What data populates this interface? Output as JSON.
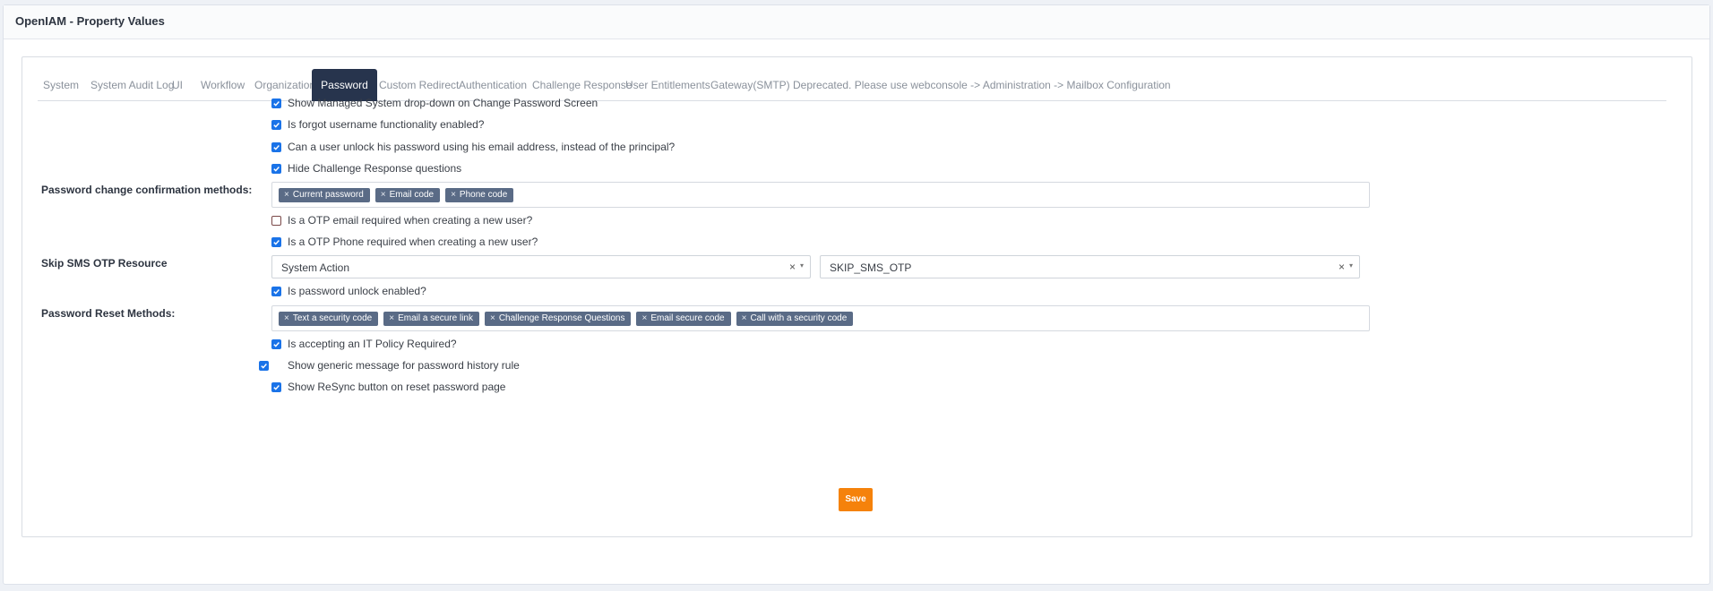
{
  "header": {
    "title": "OpenIAM - Property Values"
  },
  "tabs": [
    {
      "label": "System"
    },
    {
      "label": "System Audit Log"
    },
    {
      "label": "UI"
    },
    {
      "label": "Workflow"
    },
    {
      "label": "Organization"
    },
    {
      "label": "Password",
      "active": true
    },
    {
      "label": "Custom Redirect"
    },
    {
      "label": "Authentication"
    },
    {
      "label": "Challenge Response"
    },
    {
      "label": "User Entitlements"
    },
    {
      "label": "Gateway(SMTP) Deprecated. Please use webconsole -> Administration -> Mailbox Configuration"
    }
  ],
  "form": {
    "show_managed_system": {
      "label": "Show Managed System drop-down on Change Password Screen",
      "checked": true
    },
    "forgot_username": {
      "label": "Is forgot username functionality enabled?",
      "checked": true
    },
    "unlock_by_email": {
      "label": "Can a user unlock his password using his email address, instead of the principal?",
      "checked": true
    },
    "hide_challenge": {
      "label": "Hide Challenge Response questions",
      "checked": true
    },
    "confirmation_methods": {
      "label": "Password change confirmation methods:",
      "tags": [
        "Current password",
        "Email code",
        "Phone code"
      ]
    },
    "otp_email": {
      "label": "Is a OTP email required when creating a new user?",
      "checked": false
    },
    "otp_phone": {
      "label": "Is a OTP Phone required when creating a new user?",
      "checked": true
    },
    "skip_sms": {
      "label": "Skip SMS OTP Resource",
      "select1": "System Action",
      "select2": "SKIP_SMS_OTP"
    },
    "unlock_enabled": {
      "label": "Is password unlock enabled?",
      "checked": true
    },
    "reset_methods": {
      "label": "Password Reset Methods:",
      "tags": [
        "Text a security code",
        "Email a secure link",
        "Challenge Response Questions",
        "Email secure code",
        "Call with a security code"
      ]
    },
    "it_policy": {
      "label": "Is accepting an IT Policy Required?",
      "checked": true
    },
    "generic_message": {
      "label": "Show generic message for password history rule",
      "checked": true
    },
    "resync_button": {
      "label": "Show ReSync button on reset password page",
      "checked": true
    },
    "save_label": "Save"
  },
  "icons": {
    "remove_tag": "×",
    "clear": "×",
    "caret": "▾"
  },
  "colors": {
    "active_tab": "#27344d",
    "tag": "#5a6b86",
    "checkbox": "#1a73e8",
    "save": "#f5820b"
  }
}
